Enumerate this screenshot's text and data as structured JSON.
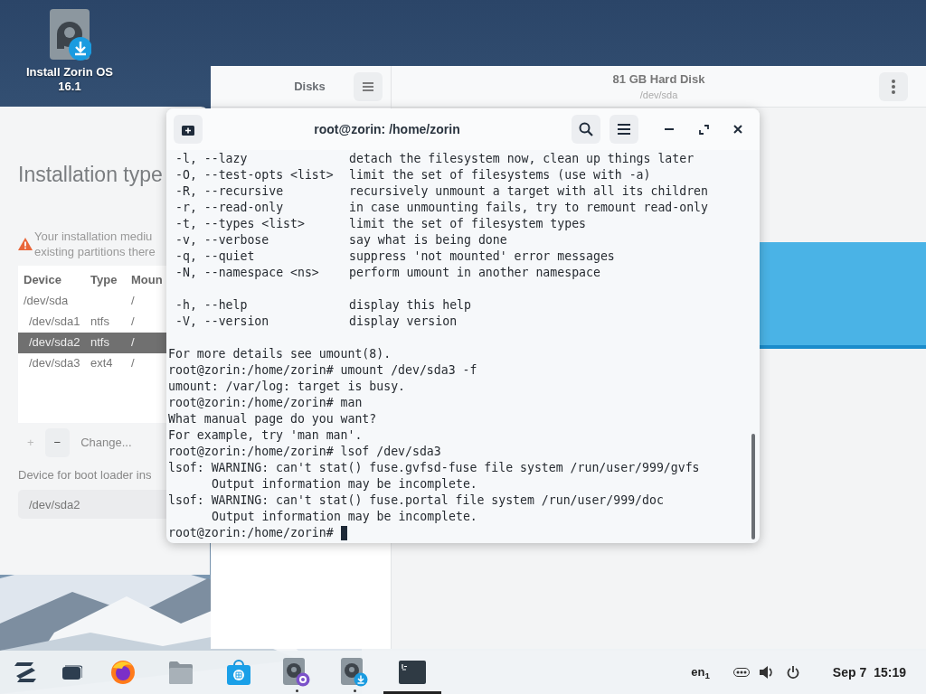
{
  "desktop_icons": [
    {
      "label": "Install Zorin OS 16.1"
    }
  ],
  "disks": {
    "sidebar_title": "Disks",
    "disk_title": "81 GB Hard Disk",
    "disk_path": "/dev/sda"
  },
  "installer": {
    "title": "Installation type",
    "warning_lines": [
      "Your installation mediu",
      "existing partitions there"
    ],
    "table": {
      "columns": [
        "Device",
        "Type",
        "Moun"
      ],
      "rows": [
        {
          "device": "/dev/sda",
          "mount": "/",
          "selected": false,
          "children": [
            {
              "device": "/dev/sda1",
              "type": "ntfs",
              "mount": "/",
              "selected": false
            },
            {
              "device": "/dev/sda2",
              "type": "ntfs",
              "mount": "/",
              "selected": true
            },
            {
              "device": "/dev/sda3",
              "type": "ext4",
              "mount": "/",
              "selected": false
            }
          ]
        }
      ]
    },
    "buttons": [
      {
        "label": "+",
        "disabled": true
      },
      {
        "label": "−",
        "disabled": false
      },
      {
        "label": "Change...",
        "disabled": false
      }
    ],
    "boot_loader": {
      "label": "Device for boot loader ins",
      "value": "/dev/sda2"
    }
  },
  "terminal": {
    "title": "root@zorin: /home/zorin",
    "blocks": [
      {
        "kind": "options",
        "items": [
          {
            "option": "-l, --lazy",
            "description": "detach the filesystem now, clean up things later"
          },
          {
            "option": "-O, --test-opts <list>",
            "description": "limit the set of filesystems (use with -a)"
          },
          {
            "option": "-R, --recursive",
            "description": "recursively unmount a target with all its children"
          },
          {
            "option": "-r, --read-only",
            "description": "in case unmounting fails, try to remount read-only"
          },
          {
            "option": "-t, --types <list>",
            "description": "limit the set of filesystem types"
          },
          {
            "option": "-v, --verbose",
            "description": "say what is being done"
          },
          {
            "option": "-q, --quiet",
            "description": "suppress 'not mounted' error messages"
          },
          {
            "option": "-N, --namespace <ns>",
            "description": "perform umount in another namespace"
          }
        ]
      },
      {
        "kind": "options",
        "items": [
          {
            "option": "-h, --help",
            "description": "display this help"
          },
          {
            "option": "-V, --version",
            "description": "display version"
          }
        ]
      },
      {
        "kind": "output",
        "lines": [
          {
            "text": "For more details see umount(8)."
          },
          {
            "text": "root@zorin:/home/zorin# umount /dev/sda3 -f"
          },
          {
            "text": "umount: /var/log: target is busy."
          },
          {
            "text": "root@zorin:/home/zorin# man"
          },
          {
            "text": "What manual page do you want?"
          },
          {
            "text": "For example, try 'man man'."
          },
          {
            "text": "root@zorin:/home/zorin# lsof /dev/sda3"
          },
          {
            "text": "lsof: WARNING: can't stat() fuse.gvfsd-fuse file system /run/user/999/gvfs",
            "children": [
              {
                "text": "Output information may be incomplete."
              }
            ]
          },
          {
            "text": "lsof: WARNING: can't stat() fuse.portal file system /run/user/999/doc",
            "children": [
              {
                "text": "Output information may be incomplete."
              }
            ]
          }
        ]
      }
    ],
    "prompt": "root@zorin:/home/zorin#"
  },
  "taskbar": {
    "apps": [
      {
        "kind": "browser",
        "running": false,
        "selected": false
      },
      {
        "kind": "folder",
        "running": false,
        "selected": false
      },
      {
        "kind": "store",
        "running": false,
        "selected": false
      },
      {
        "kind": "disk-gear",
        "running": true,
        "selected": false
      },
      {
        "kind": "disk-download",
        "running": true,
        "selected": false
      },
      {
        "kind": "terminal",
        "running": true,
        "selected": true
      }
    ],
    "keyboard_layout": "en$_{1}$",
    "date": "Sep 7",
    "time": "15:19"
  }
}
